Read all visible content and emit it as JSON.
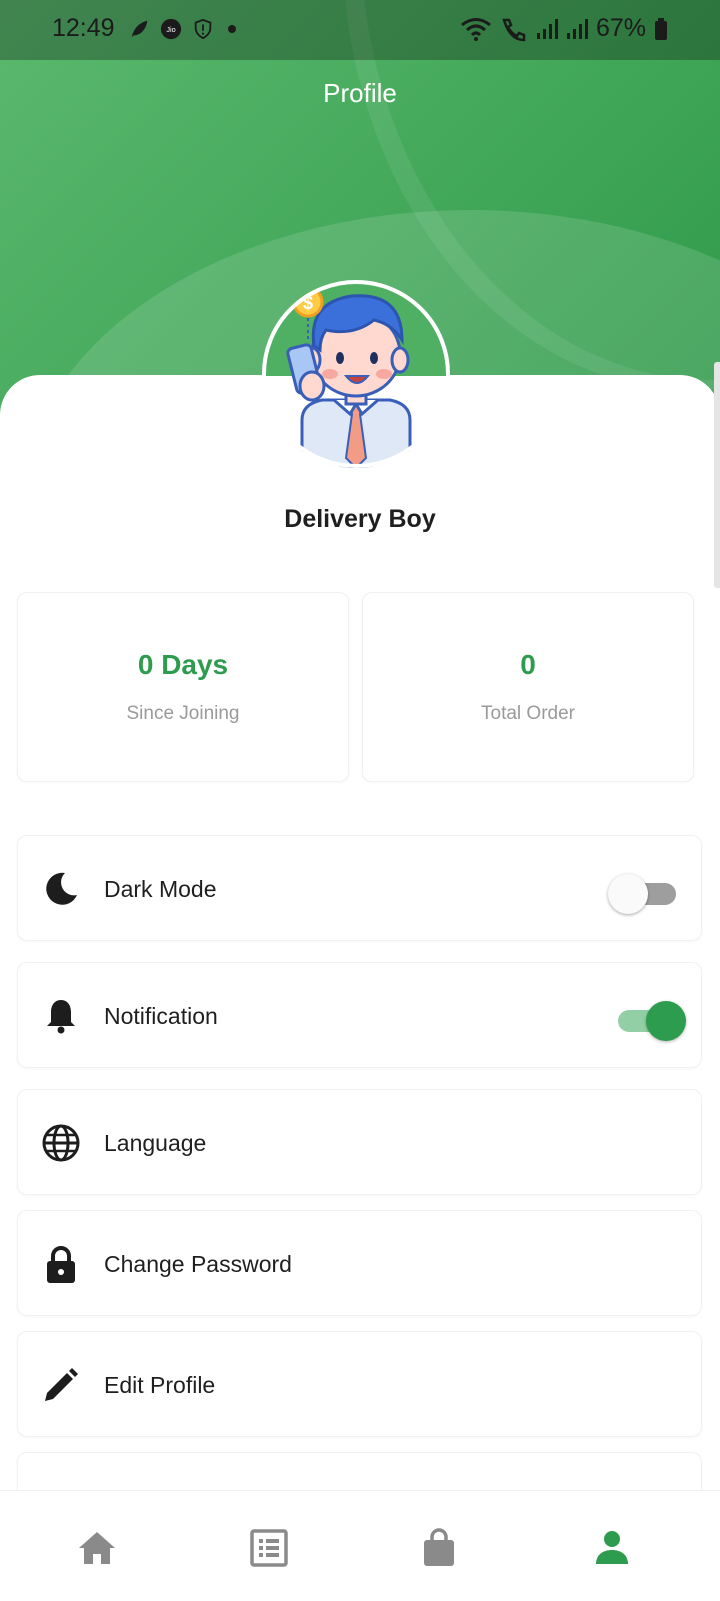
{
  "status_bar": {
    "time": "12:49",
    "battery": "67%"
  },
  "header": {
    "title": "Profile"
  },
  "profile": {
    "name": "Delivery Boy"
  },
  "stats": [
    {
      "value": "0 Days",
      "label": "Since Joining"
    },
    {
      "value": "0",
      "label": "Total Order"
    }
  ],
  "menu": [
    {
      "label": "Dark Mode",
      "icon": "moon-icon",
      "toggle": false
    },
    {
      "label": "Notification",
      "icon": "bell-icon",
      "toggle": true
    },
    {
      "label": "Language",
      "icon": "globe-icon"
    },
    {
      "label": "Change Password",
      "icon": "lock-icon"
    },
    {
      "label": "Edit Profile",
      "icon": "pencil-icon"
    }
  ],
  "bottom_nav": [
    {
      "icon": "home-icon",
      "active": false
    },
    {
      "icon": "list-icon",
      "active": false
    },
    {
      "icon": "bag-icon",
      "active": false
    },
    {
      "icon": "person-icon",
      "active": true
    }
  ],
  "colors": {
    "accent": "#2e9c4e",
    "header_green": "#43a85a",
    "inactive_icon": "#8a8a8a"
  }
}
